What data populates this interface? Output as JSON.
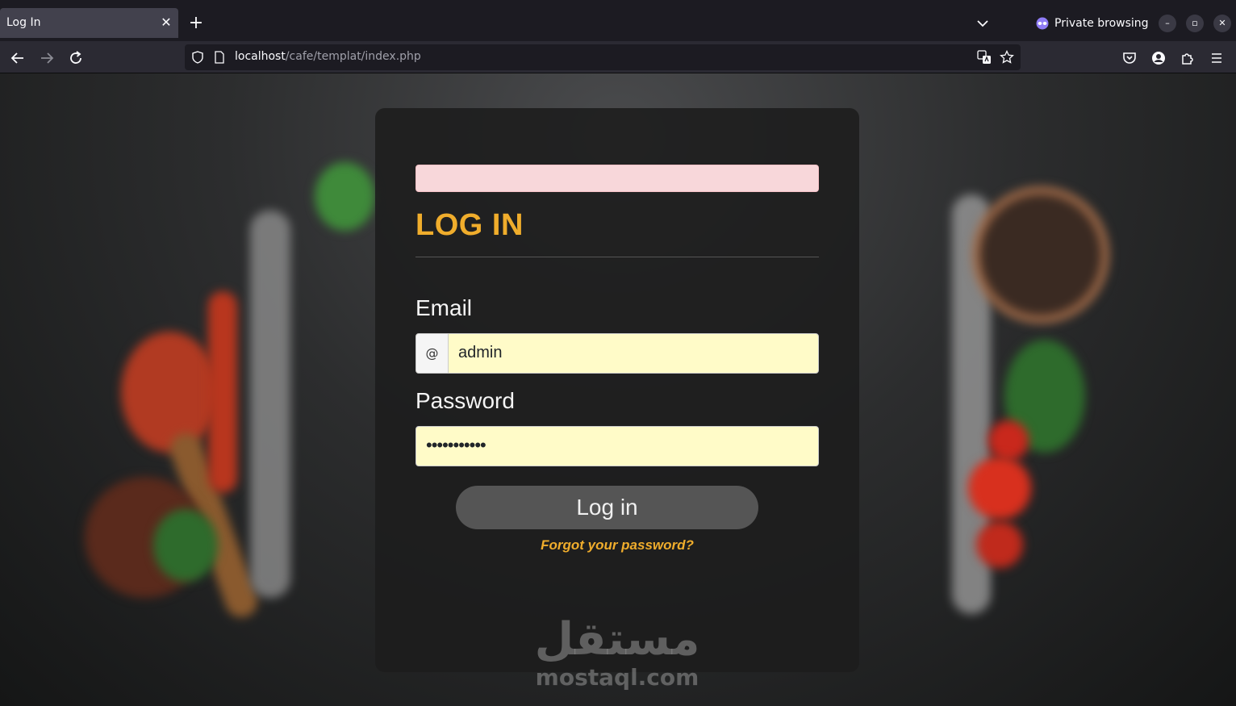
{
  "browser": {
    "tab": {
      "title": "Log In",
      "close_glyph": "✕"
    },
    "new_tab_glyph": "+",
    "private_label": "Private browsing",
    "window_controls": {
      "minimize": "–",
      "restore": "▫",
      "close": "✕"
    },
    "url": {
      "host": "localhost",
      "path": "/cafe/templat/index.php"
    }
  },
  "page": {
    "title": "LOG IN",
    "email": {
      "label": "Email",
      "addon": "@",
      "value": "admin"
    },
    "password": {
      "label": "Password",
      "value": "•••••••••••"
    },
    "submit_label": "Log in",
    "forgot_link": "Forgot your password?",
    "watermark": {
      "arabic": "مستقل",
      "latin": "mostaql.com"
    }
  },
  "colors": {
    "accent": "#f0ad2c",
    "alert_bg": "#f8d7da",
    "input_autofill_bg": "#fffbc8",
    "button_bg": "#555555"
  }
}
